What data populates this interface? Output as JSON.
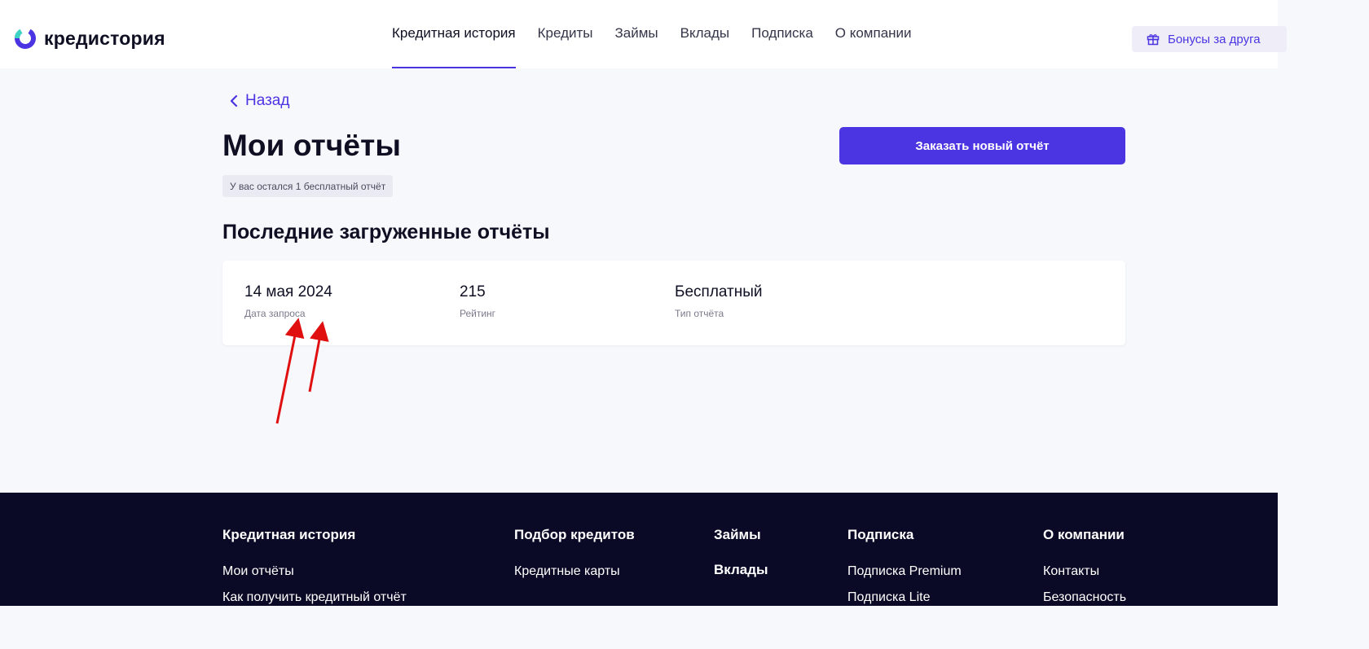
{
  "header": {
    "logo_text": "кредистория",
    "nav": [
      {
        "label": "Кредитная история",
        "active": true
      },
      {
        "label": "Кредиты"
      },
      {
        "label": "Займы"
      },
      {
        "label": "Вклады"
      },
      {
        "label": "Подписка"
      },
      {
        "label": "О компании"
      }
    ],
    "bonus_label": "Бонусы за друга"
  },
  "main": {
    "back_label": "Назад",
    "title": "Мои отчёты",
    "order_button": "Заказать новый отчёт",
    "free_badge": "У вас остался 1 бесплатный отчёт",
    "section_title": "Последние загруженные отчёты",
    "report": {
      "date": "14 мая 2024",
      "date_label": "Дата запроса",
      "rating": "215",
      "rating_label": "Рейтинг",
      "type": "Бесплатный",
      "type_label": "Тип отчёта"
    }
  },
  "footer": {
    "columns": [
      {
        "heading": "Кредитная история",
        "links": [
          "Мои отчёты",
          "Как получить кредитный отчёт"
        ]
      },
      {
        "heading": "Подбор кредитов",
        "links": [
          "Кредитные карты"
        ]
      },
      {
        "heading": "Займы",
        "links": []
      },
      {
        "heading": "Вклады",
        "links": []
      },
      {
        "heading": "Подписка",
        "links": [
          "Подписка Premium",
          "Подписка Lite"
        ]
      },
      {
        "heading": "О компании",
        "links": [
          "Контакты",
          "Безопасность"
        ]
      }
    ]
  },
  "colors": {
    "accent": "#4b35e2",
    "background": "#f7f8fc",
    "footer": "#0a0a26",
    "annotation_arrow": "#e01010"
  }
}
